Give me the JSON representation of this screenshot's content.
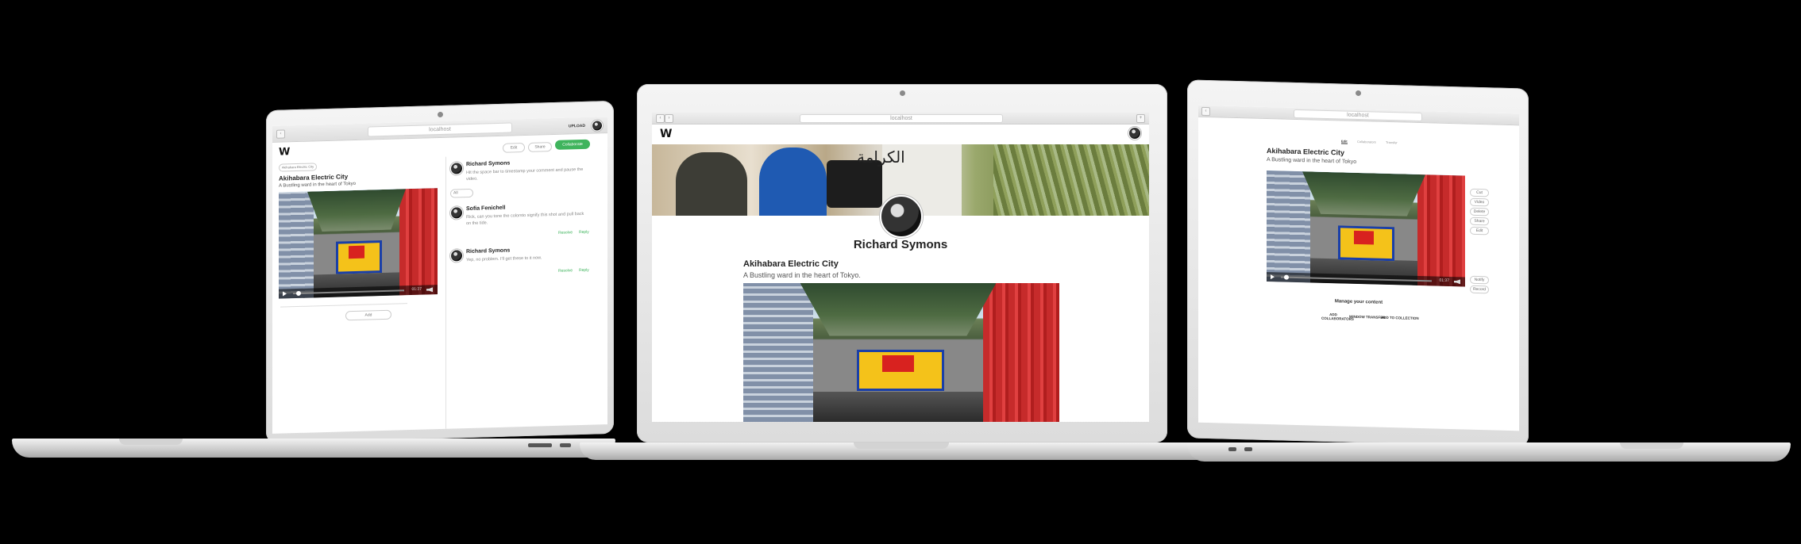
{
  "left_laptop": {
    "browser": {
      "url": "localhost"
    },
    "header": {
      "logo": "W",
      "upload_label": "UPLOAD"
    },
    "toolbar": {
      "edit_label": "Edit",
      "share_label": "Share",
      "collaborate_label": "Collaborate"
    },
    "back_label": "Akihabara Electric City",
    "content": {
      "title": "Akihabara Electric City",
      "subtitle": "A Bustling ward in the heart of Tokyo"
    },
    "video": {
      "time": "01:37"
    },
    "pagination": {
      "label": "Add"
    },
    "comments": [
      {
        "name": "Richard Symons",
        "text": "Hit the space bar to timestamp your comment and pause the video."
      },
      {
        "name": "Sofia Fenichell",
        "text": "Rick, can you tone the colorsto signify this shot and pull back on the tide.",
        "actions": [
          "Resolve",
          "Reply"
        ]
      },
      {
        "name": "Richard Symons",
        "text": "Yep, no problem. I'll get these to it now.",
        "actions": [
          "Resolve",
          "Reply"
        ]
      }
    ],
    "comment_input": {
      "placeholder": "All"
    }
  },
  "center_laptop": {
    "browser": {
      "url": "localhost"
    },
    "header": {
      "logo": "W"
    },
    "banner": {
      "arabic_sign": "الكرامة"
    },
    "profile": {
      "name": "Richard Symons"
    },
    "content": {
      "title": "Akihabara Electric City",
      "subtitle": "A Bustling ward in the heart of Tokyo."
    }
  },
  "right_laptop": {
    "browser": {
      "url": "localhost"
    },
    "tabs": [
      "Edit",
      "Collaborators",
      "Transfer"
    ],
    "content": {
      "title": "Akihabara Electric City",
      "subtitle": "A Bustling ward in the heart of Tokyo"
    },
    "side_buttons": [
      "Cut",
      "Video",
      "Delete",
      "Share",
      "Edit"
    ],
    "bottom_side_buttons": [
      "Notify",
      "Record"
    ],
    "video": {
      "time": "01:37"
    },
    "manage": {
      "title": "Manage your content",
      "actions": [
        "ADD COLLABORATORS",
        "WINDOW TRANSFER",
        "ADD TO COLLECTION"
      ]
    }
  }
}
